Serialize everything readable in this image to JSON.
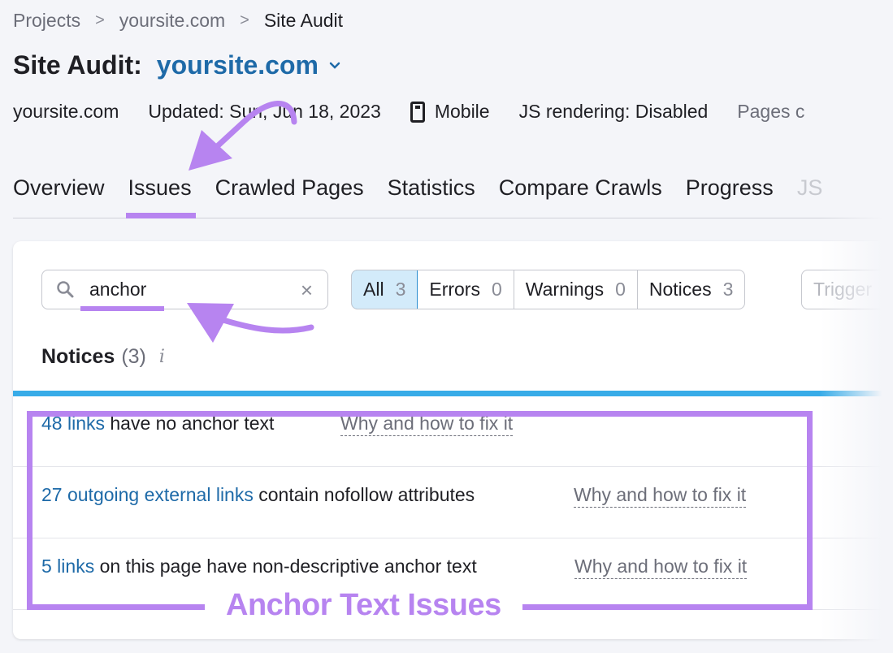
{
  "breadcrumb": {
    "items": [
      "Projects",
      "yoursite.com",
      "Site Audit"
    ],
    "separator": ">"
  },
  "header": {
    "title_prefix": "Site Audit:",
    "site": "yoursite.com"
  },
  "meta": {
    "domain": "yoursite.com",
    "updated": "Updated: Sun, Jun 18, 2023",
    "device": "Mobile",
    "js_rendering": "JS rendering: Disabled",
    "pages": "Pages c"
  },
  "tabs": [
    {
      "label": "Overview",
      "active": false
    },
    {
      "label": "Issues",
      "active": true
    },
    {
      "label": "Crawled Pages",
      "active": false
    },
    {
      "label": "Statistics",
      "active": false
    },
    {
      "label": "Compare Crawls",
      "active": false
    },
    {
      "label": "Progress",
      "active": false
    },
    {
      "label": "JS",
      "active": false
    }
  ],
  "search": {
    "value": "anchor",
    "clear_icon": "×"
  },
  "filters": [
    {
      "label": "All",
      "count": "3",
      "active": true
    },
    {
      "label": "Errors",
      "count": "0",
      "active": false
    },
    {
      "label": "Warnings",
      "count": "0",
      "active": false
    },
    {
      "label": "Notices",
      "count": "3",
      "active": false
    }
  ],
  "trigger_placeholder": "Trigger",
  "section": {
    "title": "Notices",
    "count": "(3)",
    "info_icon": "i"
  },
  "issues": [
    {
      "link": "48 links",
      "text": " have no anchor text",
      "fix": "Why and how to fix it"
    },
    {
      "link": "27 outgoing external links",
      "text": " contain nofollow attributes",
      "fix": "Why and how to fix it"
    },
    {
      "link": "5 links",
      "text": " on this page have non-descriptive anchor text",
      "fix": "Why and how to fix it"
    }
  ],
  "annotation": {
    "label": "Anchor Text Issues",
    "color": "#b784f0"
  },
  "colors": {
    "accent_blue": "#1e6aa8",
    "active_filter_bg": "#d3ebfa",
    "progress_bar": "#38ace8",
    "annotation_purple": "#b784f0"
  }
}
